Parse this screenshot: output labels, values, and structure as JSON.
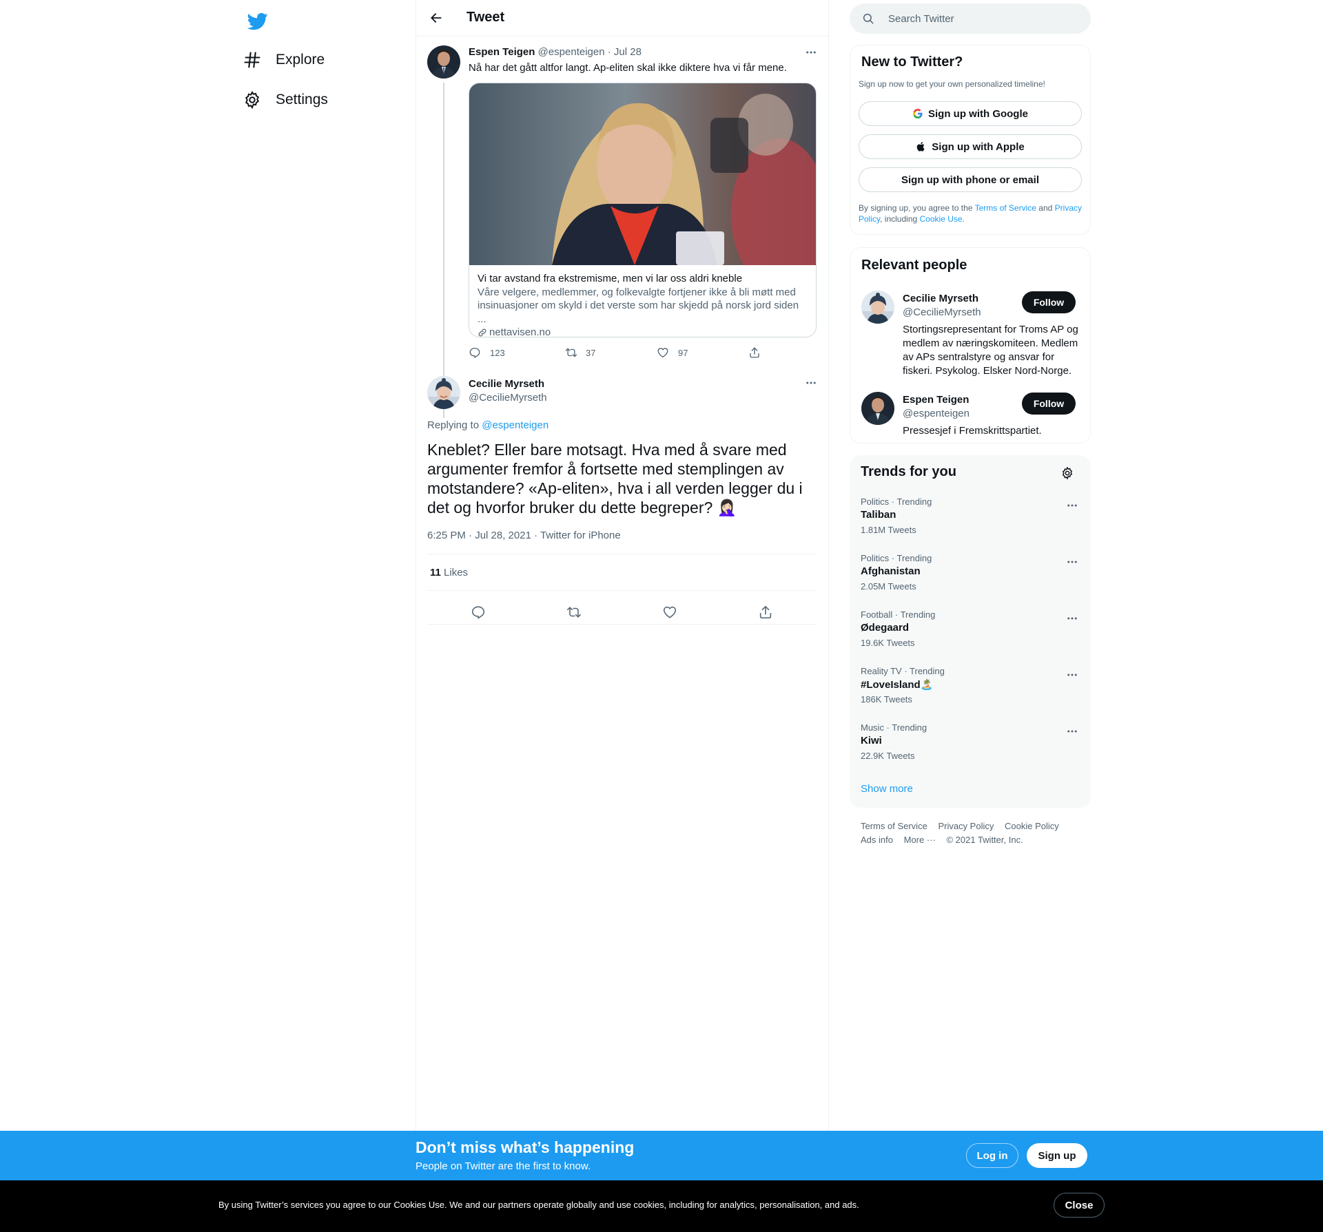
{
  "colors": {
    "brand": "#1d9bf0",
    "text_primary": "#0f1419",
    "text_secondary": "#536471",
    "border": "#eff3f4",
    "follow_bg": "#0f1419",
    "cookie_bg": "#000000"
  },
  "nav": {
    "logo_icon": "twitter-bird-icon",
    "items": [
      {
        "label": "Explore",
        "icon": "hashtag-icon"
      },
      {
        "label": "Settings",
        "icon": "gear-icon"
      }
    ]
  },
  "header": {
    "title": "Tweet",
    "back_icon": "arrow-left-icon"
  },
  "parent_tweet": {
    "author_name": "Espen Teigen",
    "author_handle": "@espenteigen",
    "date": "· Jul 28",
    "text": "Nå har det gått altfor langt. Ap-eliten skal ikke diktere hva vi får mene.",
    "card": {
      "title": "Vi tar avstand fra ekstremisme, men vi lar oss aldri kneble",
      "description": "Våre velgere, medlemmer, og folkevalgte fortjener ikke å bli møtt med insinuasjoner om skyld i det verste som har skjedd på norsk jord siden ...",
      "domain": "nettavisen.no"
    },
    "actions": {
      "replies": "123",
      "retweets": "37",
      "likes": "97"
    }
  },
  "focus_tweet": {
    "author_name": "Cecilie Myrseth",
    "author_handle": "@CecilieMyrseth",
    "replying_prefix": "Replying to",
    "replying_to": "@espenteigen",
    "text": "Kneblet? Eller bare motsagt. Hva med å svare med argumenter fremfor å fortsette med stemplingen av motstandere? «Ap-eliten», hva i all verden legger du i det og hvorfor bruker du dette begreper? 🤦🏻‍♀️",
    "meta": "6:25 PM · Jul 28, 2021 · Twitter for iPhone",
    "likes_count": "11",
    "likes_label": "Likes"
  },
  "search": {
    "placeholder": "Search Twitter"
  },
  "new_to_twitter": {
    "title": "New to Twitter?",
    "subtitle": "Sign up now to get your own personalized timeline!",
    "google_label": "Sign up with Google",
    "apple_label": "Sign up with Apple",
    "phone_label": "Sign up with phone or email",
    "terms_1": "By signing up, you agree to the",
    "terms_link": "Terms of Service",
    "terms_2": "and",
    "privacy_link": "Privacy Policy",
    "terms_3": ", including",
    "cookie_link": "Cookie Use."
  },
  "relevant_people": {
    "title": "Relevant people",
    "follow_label": "Follow",
    "people": [
      {
        "name": "Cecilie Myrseth",
        "handle": "@CecilieMyrseth",
        "bio": "Stortingsrepresentant for Troms AP og medlem av næringskomiteen. Medlem av APs sentralstyre og ansvar for fiskeri. Psykolog. Elsker Nord-Norge."
      },
      {
        "name": "Espen Teigen",
        "handle": "@espenteigen",
        "bio": "Pressesjef i Fremskrittspartiet."
      }
    ]
  },
  "trends": {
    "title": "Trends for you",
    "items": [
      {
        "context": "Politics · Trending",
        "name": "Taliban",
        "count": "1.81M Tweets"
      },
      {
        "context": "Politics · Trending",
        "name": "Afghanistan",
        "count": "2.05M Tweets"
      },
      {
        "context": "Football · Trending",
        "name": "Ødegaard",
        "count": "19.6K Tweets"
      },
      {
        "context": "Reality TV · Trending",
        "name": "#LoveIsland🏝️",
        "count": "186K Tweets"
      },
      {
        "context": "Music · Trending",
        "name": "Kiwi",
        "count": "22.9K Tweets"
      }
    ],
    "show_more": "Show more"
  },
  "footer": {
    "terms": "Terms of Service",
    "privacy": "Privacy Policy",
    "cookie": "Cookie Policy",
    "ads": "Ads info",
    "more": "More ···",
    "copyright": "© 2021 Twitter, Inc."
  },
  "signup_bar": {
    "title": "Don’t miss what’s happening",
    "subtitle": "People on Twitter are the first to know.",
    "login_label": "Log in",
    "signup_label": "Sign up"
  },
  "cookie_bar": {
    "text": "By using Twitter’s services you agree to our Cookies Use. We and our partners operate globally and use cookies, including for analytics, personalisation, and ads.",
    "close_label": "Close"
  }
}
